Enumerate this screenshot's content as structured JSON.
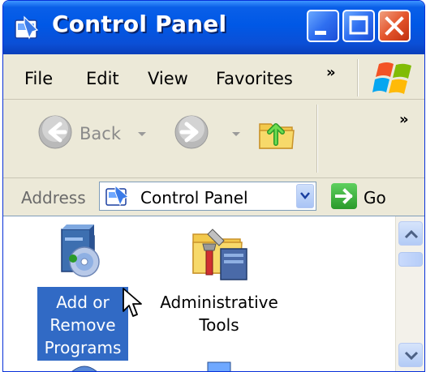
{
  "window": {
    "title": "Control Panel",
    "title_icon": "control-panel-icon",
    "buttons": [
      "minimize-icon",
      "maximize-icon",
      "close-icon"
    ]
  },
  "menubar": {
    "items": [
      {
        "label": "File"
      },
      {
        "label": "Edit"
      },
      {
        "label": "View"
      },
      {
        "label": "Favorites"
      }
    ],
    "overflow_chevron": "»"
  },
  "toolbar": {
    "back_label": "Back",
    "overflow_chevron": "»"
  },
  "address": {
    "label": "Address",
    "value": "Control Panel",
    "go_label": "Go"
  },
  "content": {
    "items": [
      {
        "lines": [
          "Add or",
          "Remove",
          "Programs"
        ],
        "selected": true,
        "icon": "add-remove-programs-icon"
      },
      {
        "lines": [
          "Administrative",
          "Tools"
        ],
        "selected": false,
        "icon": "administrative-tools-icon"
      }
    ]
  },
  "colors": {
    "titlebar": "#0058e6",
    "selection": "#316ac5",
    "chrome": "#ece9d8"
  }
}
